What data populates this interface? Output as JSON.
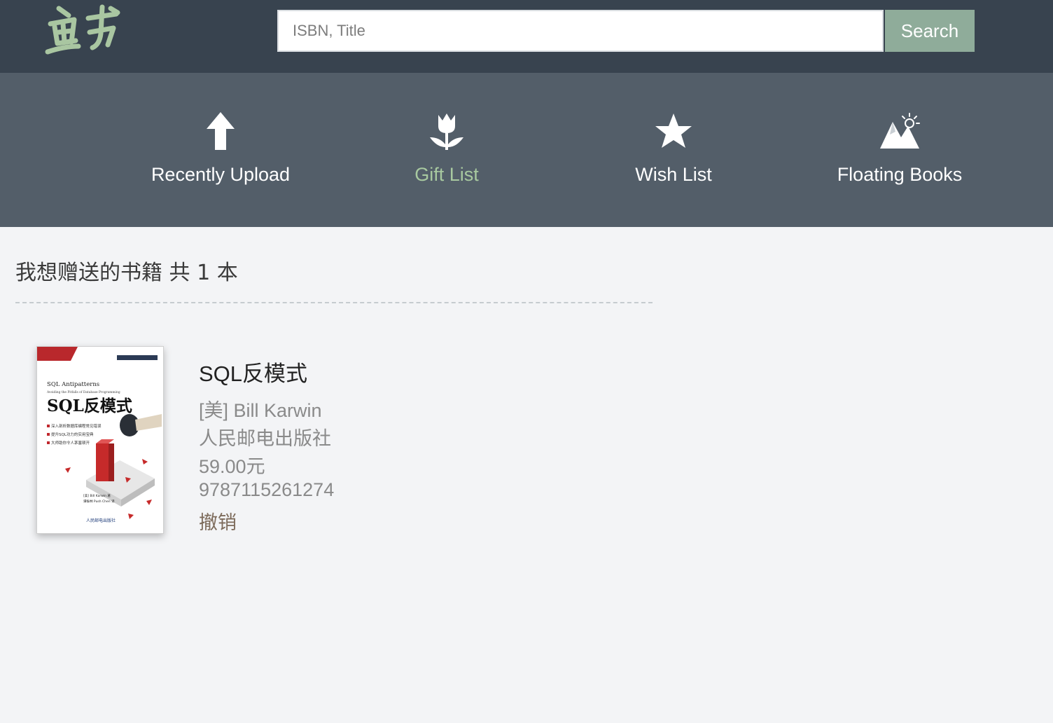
{
  "header": {
    "logo_text": "鱼书",
    "search": {
      "placeholder": "ISBN, Title",
      "value": ""
    },
    "search_button": "Search"
  },
  "nav": {
    "items": [
      {
        "label": "Recently Upload",
        "icon": "arrow-up-icon",
        "active": false
      },
      {
        "label": "Gift List",
        "icon": "tulip-icon",
        "active": true
      },
      {
        "label": "Wish List",
        "icon": "star-icon",
        "active": false
      },
      {
        "label": "Floating Books",
        "icon": "mountain-icon",
        "active": false
      }
    ]
  },
  "colors": {
    "header_bg": "#38434f",
    "nav_bg": "#535e69",
    "accent": "#8fac9a",
    "active_nav": "#a8c9a0",
    "page_bg": "#f3f4f6"
  },
  "main": {
    "title": "我想赠送的书籍 共 1 本",
    "books": [
      {
        "title": "SQL反模式",
        "author": "[美] Bill Karwin",
        "publisher": "人民邮电出版社",
        "price": "59.00元",
        "isbn": "9787115261274",
        "action": "撤销",
        "cover": {
          "en_title": "SQL Antipatterns",
          "en_subtitle": "Avoiding the Pitfalls of Database Programming",
          "cn_title": "SQL反模式",
          "bullets": [
            "深入剖析数据库编程常见错误",
            "提升SQL功力的实用宝典",
            "大师助你令人茅塞顿开"
          ],
          "authors": [
            "[美] Bill Karwin 著",
            "谭振林 Push Chen 译"
          ],
          "publisher": "人民邮电出版社"
        }
      }
    ]
  }
}
